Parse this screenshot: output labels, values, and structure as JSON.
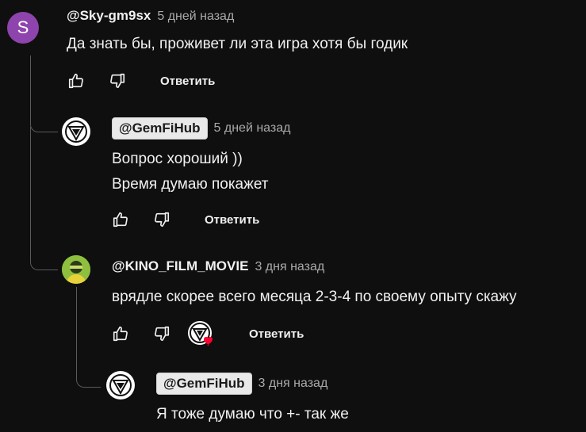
{
  "comments": [
    {
      "avatar_letter": "S",
      "author": "@Sky-gm9sx",
      "time": "5 дней назад",
      "text": "Да знать бы, проживет ли эта игра хотя бы годик",
      "reply_label": "Ответить"
    },
    {
      "author": "@GemFiHub",
      "time": "5 дней назад",
      "text_line1": "Вопрос хороший ))",
      "text_line2": "Время думаю покажет",
      "reply_label": "Ответить"
    },
    {
      "author": "@KINO_FILM_MOVIE",
      "time": "3 дня назад",
      "text": "врядле скорее всего месяца 2-3-4 по своему опыту скажу",
      "reply_label": "Ответить"
    },
    {
      "author": "@GemFiHub",
      "time": "3 дня назад",
      "text": "Я тоже думаю что +- так же"
    }
  ],
  "colors": {
    "background": "#0f0f0f",
    "avatar_s": "#8e44ad",
    "heart": "#ff0033"
  },
  "icons": [
    "thumb-up-icon",
    "thumb-down-icon",
    "creator-heart-icon",
    "gemfihub-logo-icon"
  ]
}
